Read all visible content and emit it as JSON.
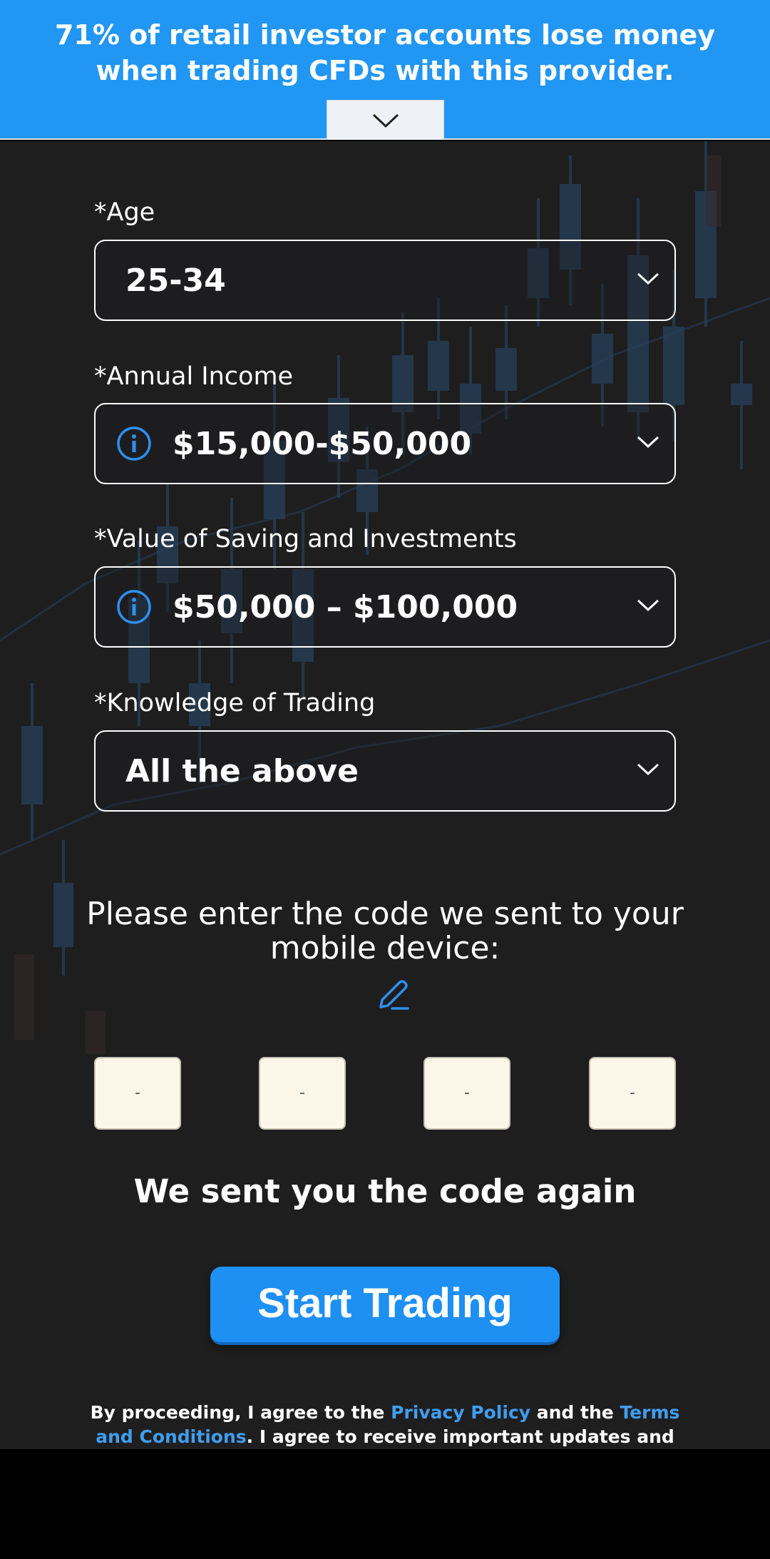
{
  "risk_banner": {
    "text": "71% of retail investor accounts lose money when trading CFDs with this provider.",
    "toggle_icon": "chevron-down-icon",
    "background_color": "#2196f3"
  },
  "form": {
    "fields": [
      {
        "label": "*Age",
        "value": "25-34",
        "has_info_icon": false
      },
      {
        "label": "*Annual Income",
        "value": "$15,000-$50,000",
        "has_info_icon": true
      },
      {
        "label": "*Value of Saving and Investments",
        "value": "$50,000 – $100,000",
        "has_info_icon": true
      },
      {
        "label": "*Knowledge of Trading",
        "value": "All the above",
        "has_info_icon": false
      }
    ]
  },
  "verification": {
    "prompt": "Please enter the code we sent to your mobile device:",
    "edit_icon": "pencil-icon",
    "digits": [
      "-",
      "-",
      "-",
      "-"
    ],
    "resent_message": "We sent you the code again"
  },
  "cta": {
    "label": "Start Trading",
    "color": "#1e8ff3"
  },
  "legal": {
    "prefix": "By proceeding, I agree to the ",
    "privacy_link": "Privacy Policy",
    "middle": " and the ",
    "terms_link": "Terms and Conditions",
    "suffix": ". I agree to receive important updates and promotions. I",
    "link_color": "#3f9ef0"
  }
}
